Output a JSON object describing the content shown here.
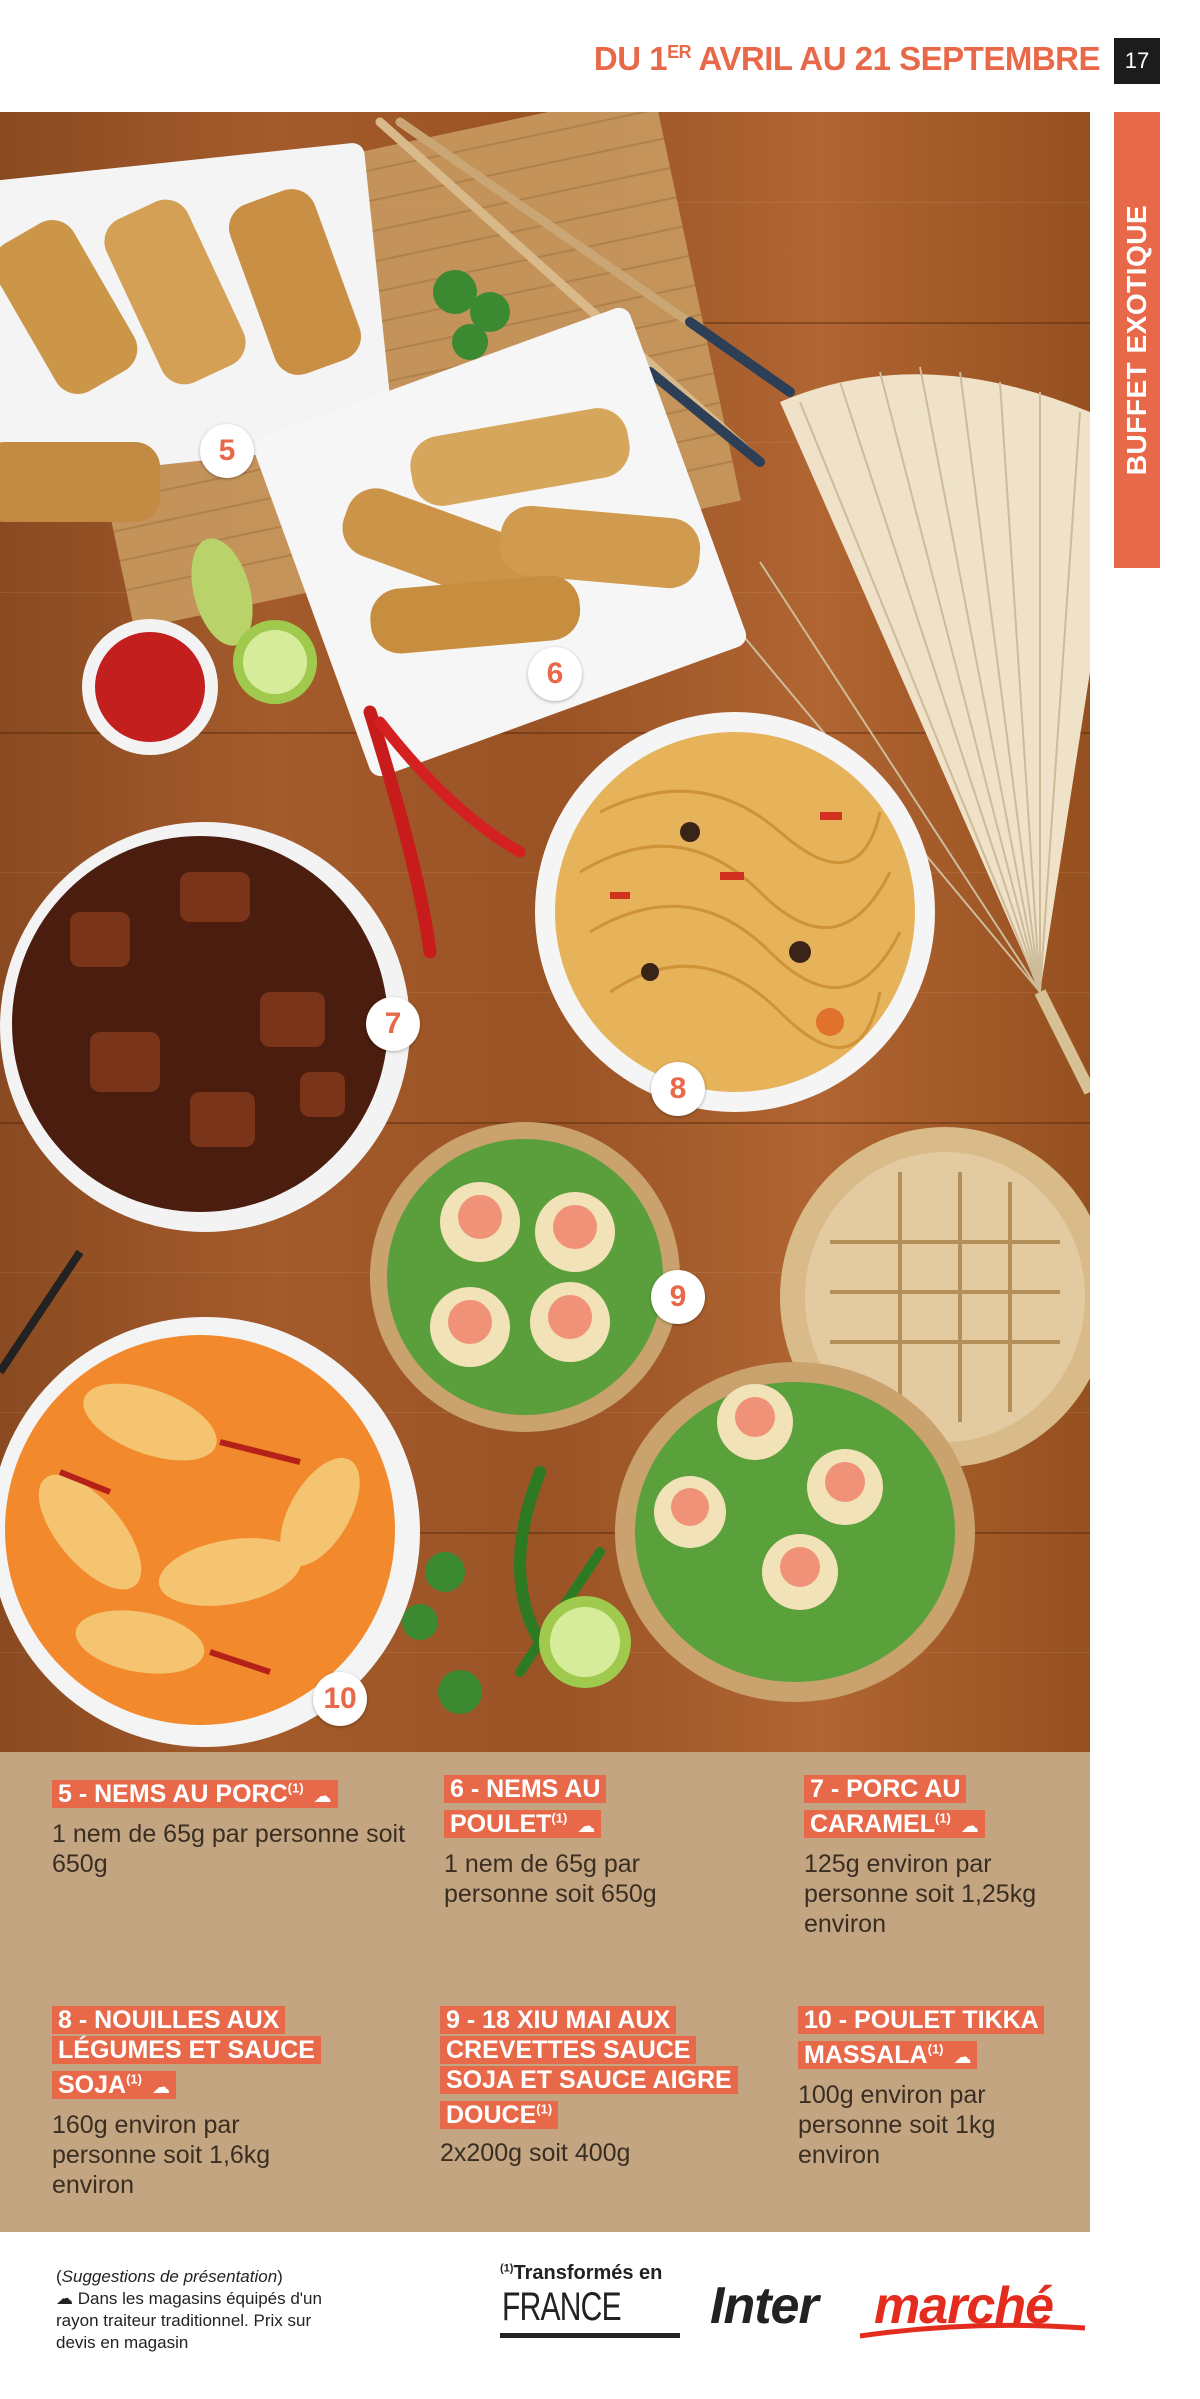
{
  "header": {
    "date_prefix": "DU 1",
    "date_sup": "ER",
    "date_suffix": " AVRIL AU 21 SEPTEMBRE",
    "page_number": "17",
    "section_tab": "BUFFET EXOTIQUE"
  },
  "photo": {
    "badges": [
      "5",
      "6",
      "7",
      "8",
      "9",
      "10"
    ]
  },
  "items": [
    {
      "title": "5 - NEMS AU PORC",
      "sup": "(1)",
      "desc": "1 nem de 65g par personne soit 650g"
    },
    {
      "title": "6 - NEMS AU POULET",
      "sup": "(1)",
      "desc": "1 nem de 65g par personne soit 650g"
    },
    {
      "title": "7 - PORC AU CARAMEL",
      "sup": "(1)",
      "desc": "125g environ par personne soit 1,25kg environ"
    },
    {
      "title": "8 - NOUILLES AUX LÉGUMES ET SAUCE SOJA",
      "sup": "(1)",
      "desc": "160g environ par personne soit 1,6kg environ"
    },
    {
      "title": "9 - 18 XIU MAI AUX CREVETTES SAUCE SOJA ET SAUCE AIGRE DOUCE",
      "sup": "(1)",
      "desc": "2x200g soit 400g"
    },
    {
      "title": "10 - POULET TIKKA MASSALA",
      "sup": "(1)",
      "desc": "100g environ par personne soit 1kg environ"
    }
  ],
  "footer": {
    "suggestion": "Suggestions de présentation",
    "note": "Dans les magasins équipés d'un rayon traiteur traditionnel. Prix sur devis en magasin",
    "france_sup": "(1)",
    "france_line1": "Transformés en",
    "france_line2": "FRANCE",
    "logo_part1": "Inter",
    "logo_part2": "marché"
  },
  "colors": {
    "accent": "#e8694a",
    "panel": "#c4a582",
    "logo_red": "#e32b1e"
  }
}
